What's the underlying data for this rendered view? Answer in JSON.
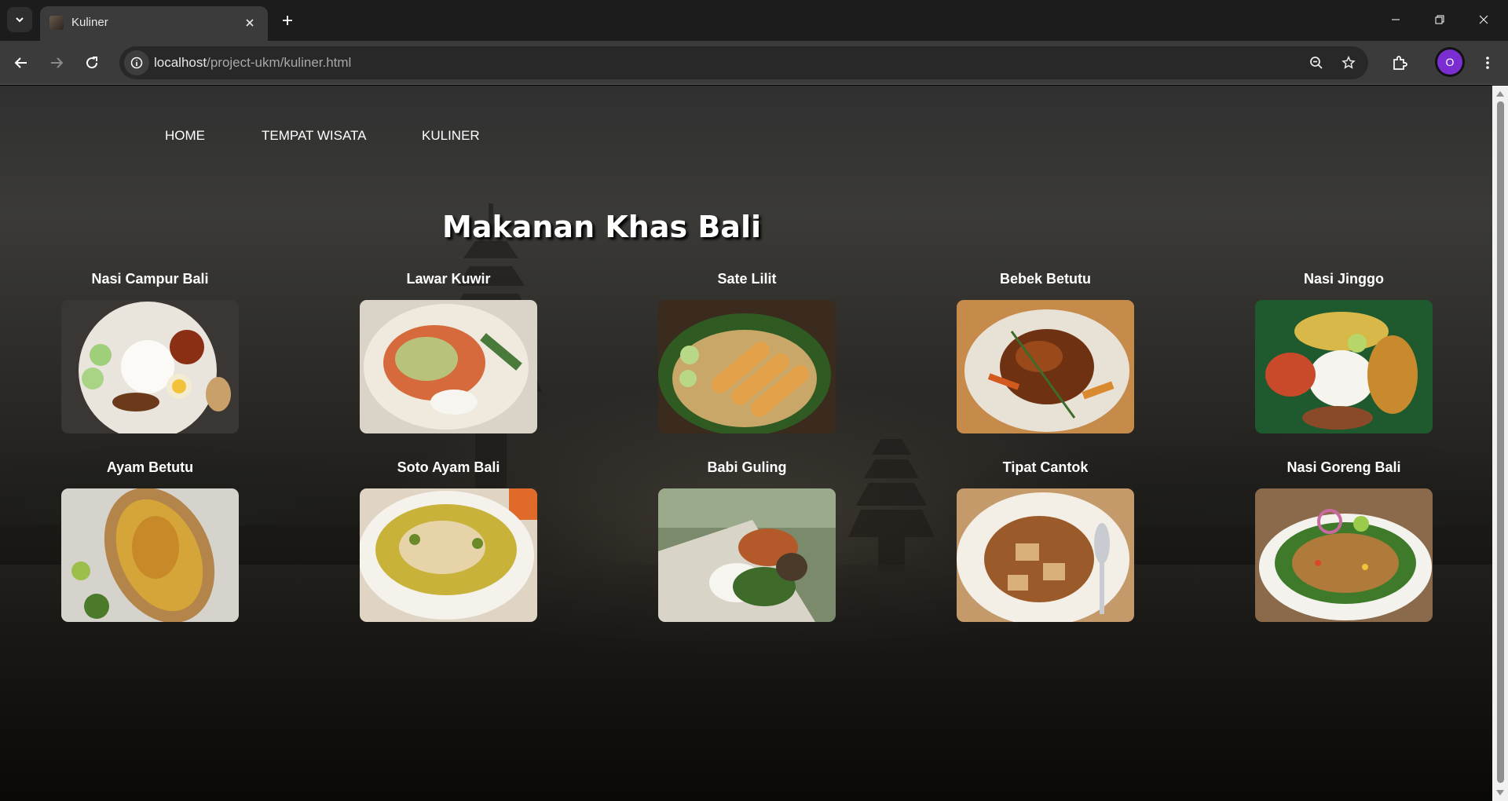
{
  "browser": {
    "tab_title": "Kuliner",
    "url_host": "localhost",
    "url_path": "/project-ukm/kuliner.html",
    "profile_initial": "O",
    "avatar_color": "#7a2ed1"
  },
  "nav": {
    "items": [
      "HOME",
      "TEMPAT WISATA",
      "KULINER"
    ]
  },
  "page_title": "Makanan Khas Bali",
  "foods": [
    {
      "name": "Nasi Campur Bali",
      "icon": "nasi-campur-photo"
    },
    {
      "name": "Lawar Kuwir",
      "icon": "lawar-photo"
    },
    {
      "name": "Sate Lilit",
      "icon": "sate-lilit-photo"
    },
    {
      "name": "Bebek Betutu",
      "icon": "bebek-betutu-photo"
    },
    {
      "name": "Nasi Jinggo",
      "icon": "nasi-jinggo-photo"
    },
    {
      "name": "Ayam Betutu",
      "icon": "ayam-betutu-photo"
    },
    {
      "name": "Soto Ayam Bali",
      "icon": "soto-ayam-photo"
    },
    {
      "name": "Babi Guling",
      "icon": "babi-guling-photo"
    },
    {
      "name": "Tipat Cantok",
      "icon": "tipat-cantok-photo"
    },
    {
      "name": "Nasi Goreng Bali",
      "icon": "nasi-goreng-photo"
    }
  ]
}
